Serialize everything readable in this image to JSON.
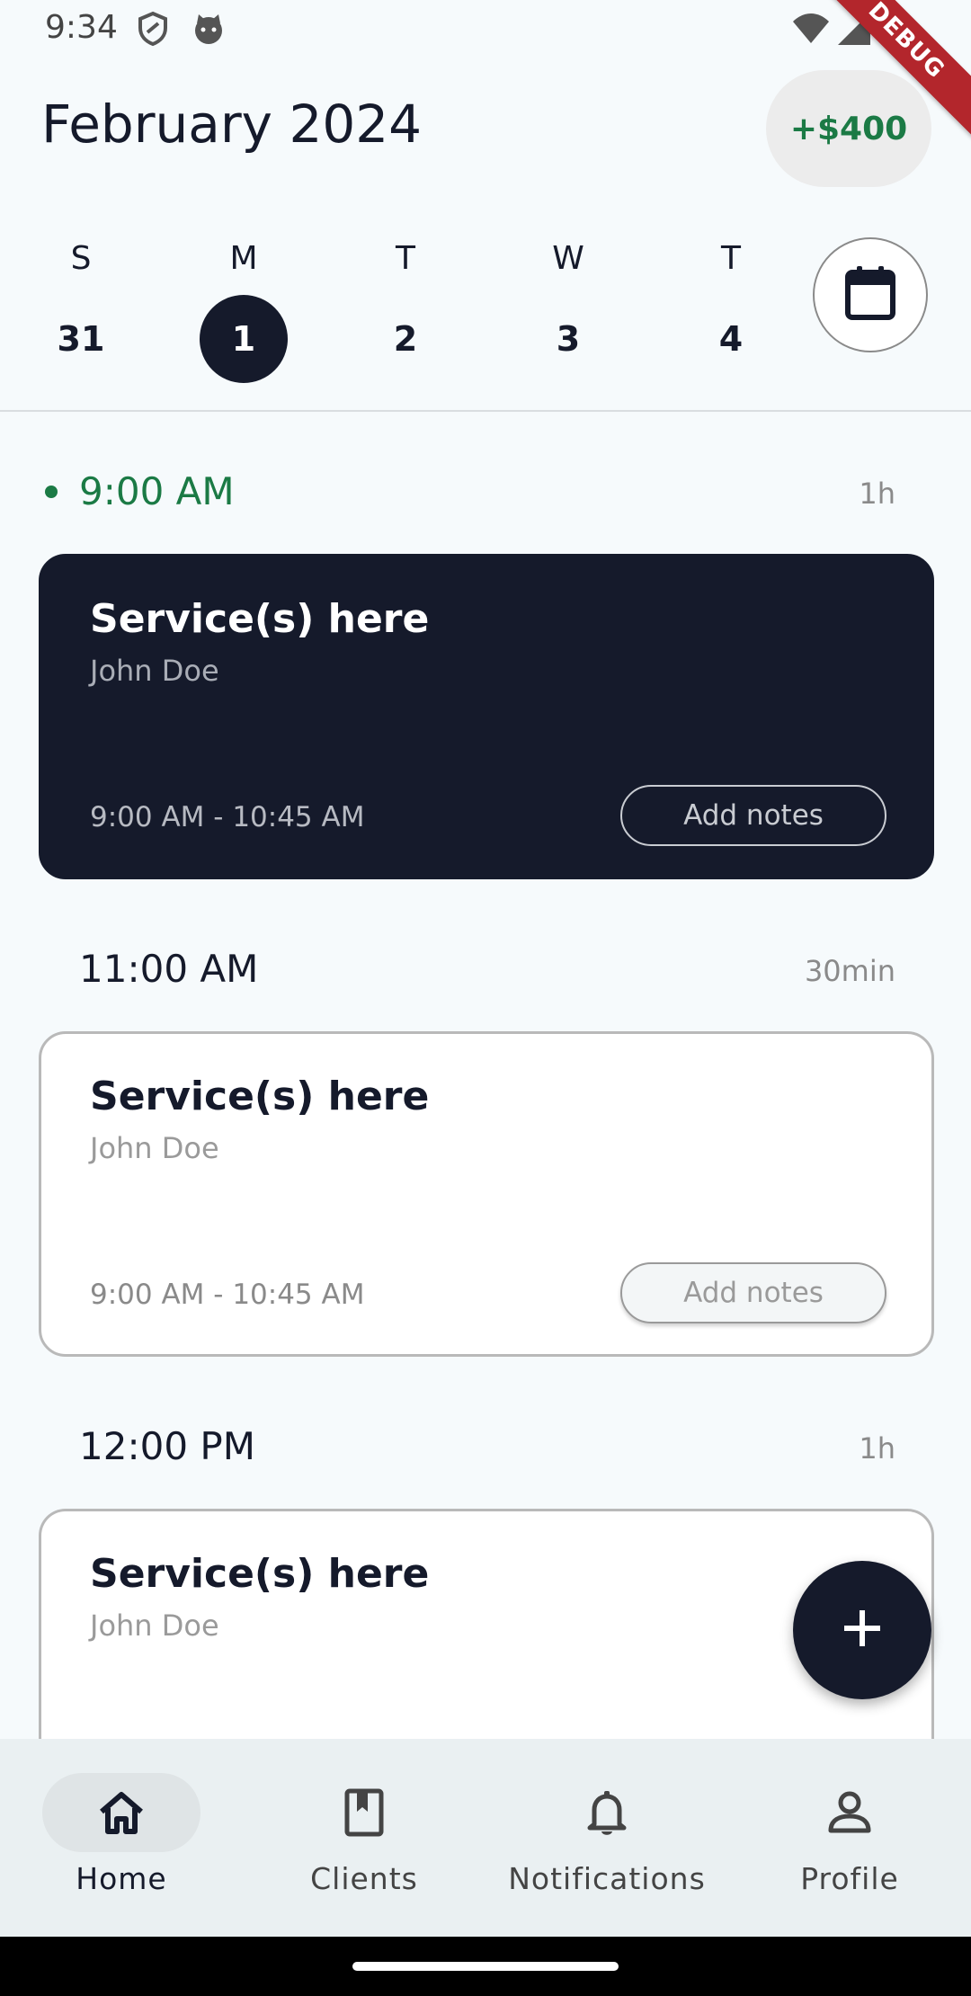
{
  "status_bar": {
    "time": "9:34"
  },
  "debug_banner": "DEBUG",
  "header": {
    "month_title": "February 2024",
    "earnings": "+$400"
  },
  "days": [
    {
      "letter": "S",
      "num": "31",
      "selected": false
    },
    {
      "letter": "M",
      "num": "1",
      "selected": true
    },
    {
      "letter": "T",
      "num": "2",
      "selected": false
    },
    {
      "letter": "W",
      "num": "3",
      "selected": false
    },
    {
      "letter": "T",
      "num": "4",
      "selected": false
    }
  ],
  "slots": [
    {
      "time": "9:00 AM",
      "duration": "1h",
      "active": true,
      "card": {
        "service": "Service(s) here",
        "client": "John Doe",
        "range": "9:00 AM - 10:45 AM",
        "notes_label": "Add notes"
      }
    },
    {
      "time": "11:00 AM",
      "duration": "30min",
      "active": false,
      "card": {
        "service": "Service(s) here",
        "client": "John Doe",
        "range": "9:00 AM - 10:45 AM",
        "notes_label": "Add notes"
      }
    },
    {
      "time": "12:00 PM",
      "duration": "1h",
      "active": false,
      "card": {
        "service": "Service(s) here",
        "client": "John Doe"
      }
    }
  ],
  "bottom_nav": {
    "items": [
      {
        "label": "Home",
        "icon": "home-icon",
        "active": true
      },
      {
        "label": "Clients",
        "icon": "book-icon",
        "active": false
      },
      {
        "label": "Notifications",
        "icon": "bell-icon",
        "active": false
      },
      {
        "label": "Profile",
        "icon": "person-icon",
        "active": false
      }
    ]
  },
  "colors": {
    "primary": "#151a2b",
    "accent_green": "#1b7a45",
    "background": "#f6fafc"
  }
}
